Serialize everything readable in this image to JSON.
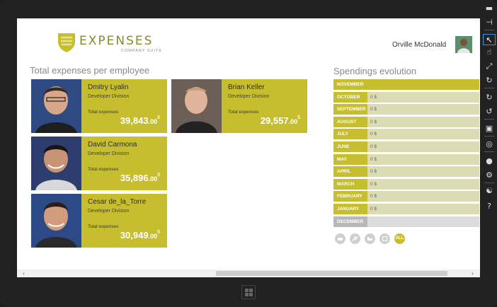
{
  "app": {
    "logo_title": "EXPENSES",
    "logo_subtitle": "COMPANY SUITE",
    "user_name": "Orville McDonald"
  },
  "employees_section": {
    "title": "Total expenses per employee",
    "total_label": "Total expenses",
    "currency": "$",
    "employees": [
      {
        "name": "Dmitry Lyalin",
        "division": "Developer Division",
        "amount_int": "39,843",
        "amount_dec": ".00"
      },
      {
        "name": "Brian Keller",
        "division": "Developer Division",
        "amount_int": "29,557",
        "amount_dec": ".00"
      },
      {
        "name": "David Carmona",
        "division": "Developer Division",
        "amount_int": "35,896",
        "amount_dec": ".00"
      },
      {
        "name": "Cesar de_la_Torre",
        "division": "Developer Division",
        "amount_int": "30,949",
        "amount_dec": ".00"
      }
    ]
  },
  "spendings": {
    "title": "Spendings evolution",
    "header_month": "NOVEMBER",
    "months": [
      {
        "label": "OCTOBER",
        "value": "0 $"
      },
      {
        "label": "SEPTEMBER",
        "value": "0 $"
      },
      {
        "label": "AUGUST",
        "value": "0 $"
      },
      {
        "label": "JULY",
        "value": "0 $"
      },
      {
        "label": "JUNE",
        "value": "0 $"
      },
      {
        "label": "MAY",
        "value": "0 $"
      },
      {
        "label": "APRIL",
        "value": "0 $"
      },
      {
        "label": "MARCH",
        "value": "0 $"
      },
      {
        "label": "FEBRUARY",
        "value": "0 $"
      },
      {
        "label": "JANUARY",
        "value": "0 $"
      }
    ],
    "disabled_month": "DECEMBER",
    "filters": {
      "all_label": "ALL"
    }
  },
  "icons": {
    "filters": [
      "restaurant-icon",
      "plane-icon",
      "hotel-icon",
      "calendar-icon"
    ],
    "simulator": [
      "minimize-icon",
      "pin-icon",
      "pointer-icon",
      "touch-icon",
      "pinch-icon",
      "rotate-icon",
      "rotate-clockwise-icon",
      "rotate-counterclockwise-icon",
      "display-icon",
      "globe-icon",
      "camera-icon",
      "settings-icon",
      "network-icon",
      "help-icon"
    ]
  },
  "colors": {
    "accent": "#c6be2e",
    "month_bg": "#dcdcb4"
  }
}
